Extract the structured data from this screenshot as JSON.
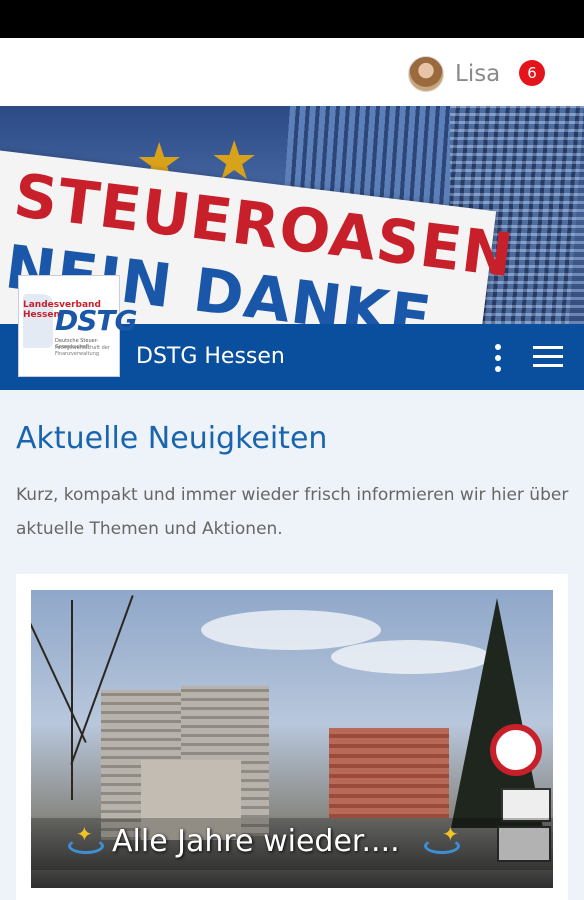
{
  "user": {
    "name": "Lisa",
    "notification_count": "6"
  },
  "hero": {
    "sign_text_line1": "STEUEROASEN",
    "sign_text_line2": "NEIN DANKE"
  },
  "header": {
    "site_name": "DSTG Hessen",
    "logo": {
      "text": "DSTG",
      "side_text": "Landesverband Hessen",
      "sub1": "Deutsche Steuer-Gewerkschaft",
      "sub2": "Fachgewerkschaft der Finanzverwaltung"
    }
  },
  "main": {
    "title": "Aktuelle Neuigkeiten",
    "intro": "Kurz, kompakt und immer wieder frisch informieren wir hier über aktuelle Themen und Aktionen."
  },
  "news": [
    {
      "caption": "Alle Jahre wieder...."
    }
  ],
  "colors": {
    "brand_blue": "#0a4f9e",
    "title_blue": "#1864ae",
    "badge_red": "#e5141b"
  },
  "icons": {
    "more": "more-vert-icon",
    "menu": "hamburger-menu-icon"
  }
}
